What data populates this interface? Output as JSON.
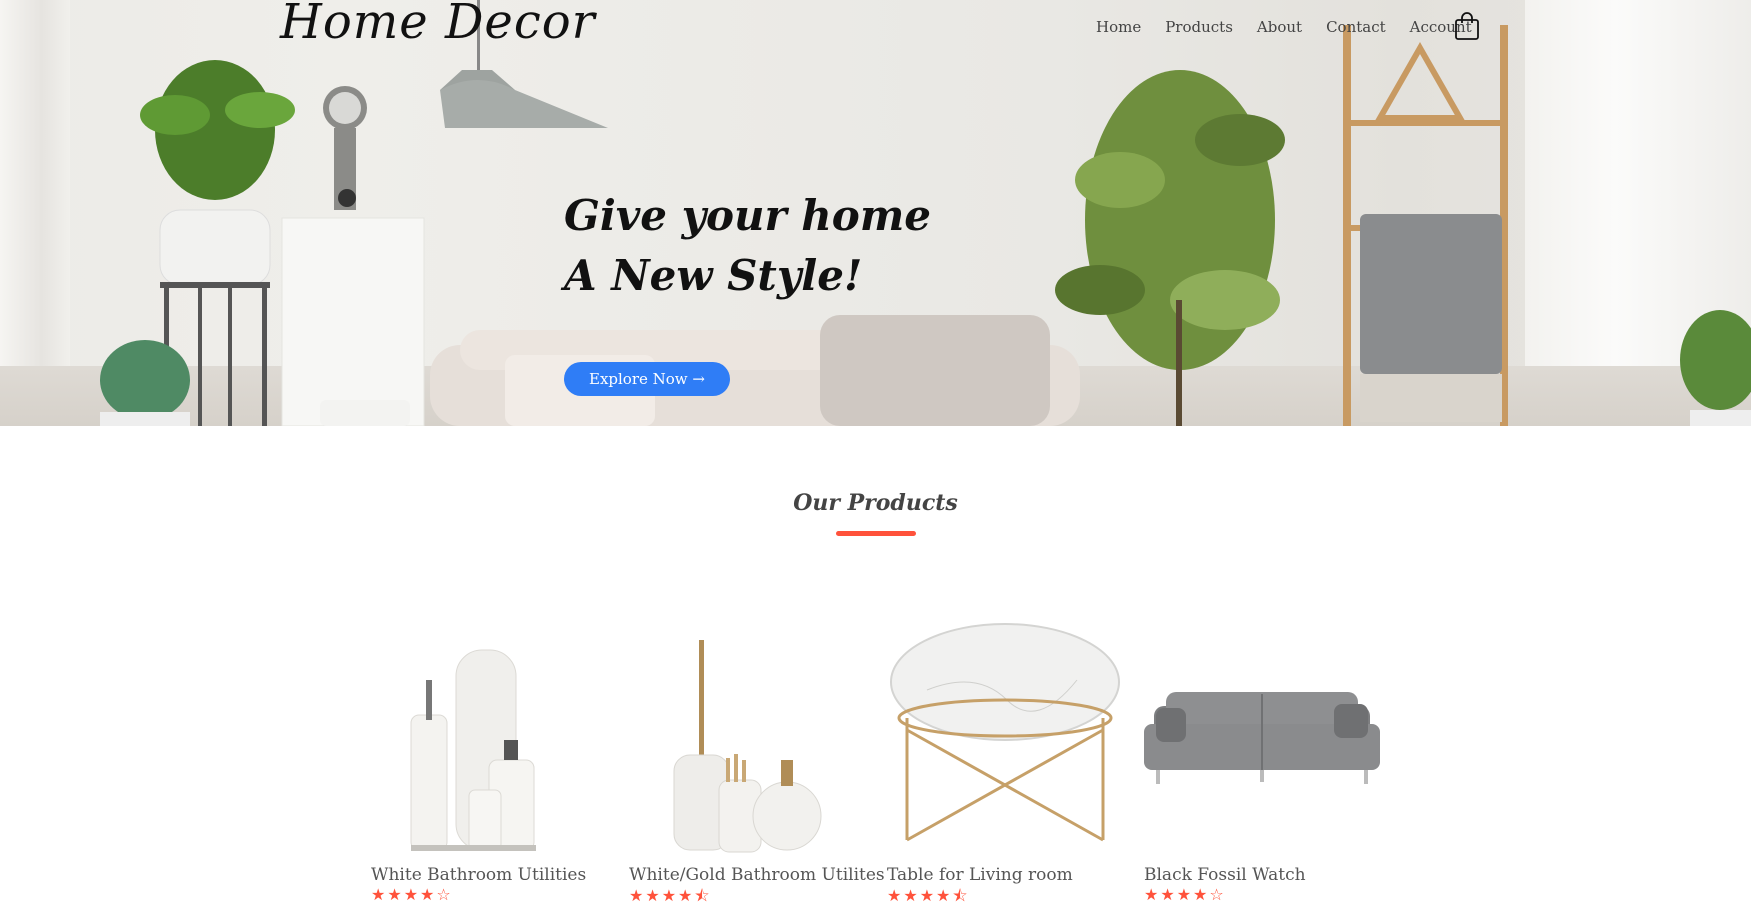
{
  "header": {
    "logo": "Home Decor",
    "nav": [
      "Home",
      "Products",
      "About",
      "Contact",
      "Account"
    ],
    "cart_icon": "shopping-bag-icon"
  },
  "hero": {
    "headline_line1": "Give your home",
    "headline_line2": "A New Style!",
    "cta_label": "Explore Now →"
  },
  "products_section": {
    "title": "Our Products",
    "accent_color": "#ff523b",
    "items": [
      {
        "name": "White Bathroom Utilities",
        "rating": 4,
        "stars": "★★★★☆"
      },
      {
        "name": "White/Gold Bathroom Utilites",
        "rating": 4.5,
        "stars": "★★★★⯪"
      },
      {
        "name": "Table for Living room",
        "rating": 4.5,
        "stars": "★★★★⯪"
      },
      {
        "name": "Black Fossil Watch",
        "rating": 4,
        "stars": "★★★★☆"
      }
    ]
  },
  "colors": {
    "button": "#2f7df6",
    "accent": "#ff523b"
  }
}
